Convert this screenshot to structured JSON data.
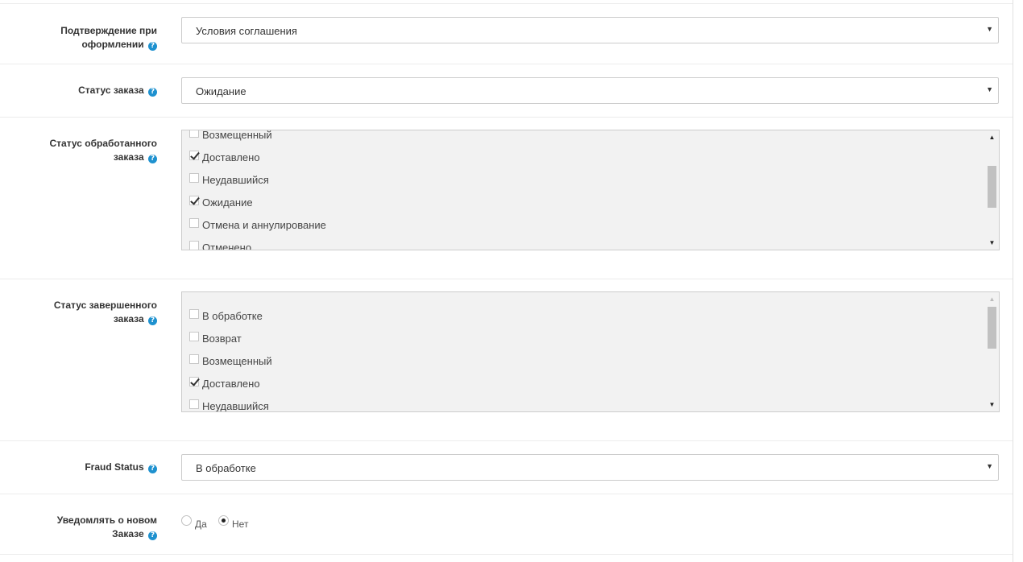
{
  "fields": {
    "checkout_confirm": {
      "label_line1": "Подтверждение при",
      "label_line2": "оформлении",
      "value": "Условия соглашения"
    },
    "order_status": {
      "label": "Статус заказа",
      "value": "Ожидание"
    },
    "processed_status": {
      "label_line1": "Статус обработанного",
      "label_line2": "заказа",
      "items": [
        {
          "label": "Возмещенный",
          "checked": false
        },
        {
          "label": "Доставлено",
          "checked": true
        },
        {
          "label": "Неудавшийся",
          "checked": false
        },
        {
          "label": "Ожидание",
          "checked": true
        },
        {
          "label": "Отмена и аннулирование",
          "checked": false
        },
        {
          "label": "Отменено",
          "checked": false
        }
      ]
    },
    "complete_status": {
      "label_line1": "Статус завершенного",
      "label_line2": "заказа",
      "items": [
        {
          "label": "В обработке",
          "checked": false
        },
        {
          "label": "Возврат",
          "checked": false
        },
        {
          "label": "Возмещенный",
          "checked": false
        },
        {
          "label": "Доставлено",
          "checked": true
        },
        {
          "label": "Неудавшийся",
          "checked": false
        }
      ]
    },
    "fraud_status": {
      "label": "Fraud Status",
      "value": "В обработке"
    },
    "notify_new_order": {
      "label_line1": "Уведомлять о новом",
      "label_line2": "Заказе",
      "options": [
        {
          "label": "Да",
          "selected": false
        },
        {
          "label": "Нет",
          "selected": true
        }
      ]
    }
  },
  "icons": {
    "help": "question-circle-icon",
    "select_arrow": "caret-down-icon",
    "scroll_up": "scroll-up-arrow-icon",
    "scroll_down": "scroll-down-arrow-icon"
  },
  "help_glyph": "?",
  "colors": {
    "help_icon": "#1e91cf",
    "scrollbox_bg": "#f2f2f2",
    "scroll_thumb": "#c1c1c1",
    "border": "#cccccc"
  }
}
